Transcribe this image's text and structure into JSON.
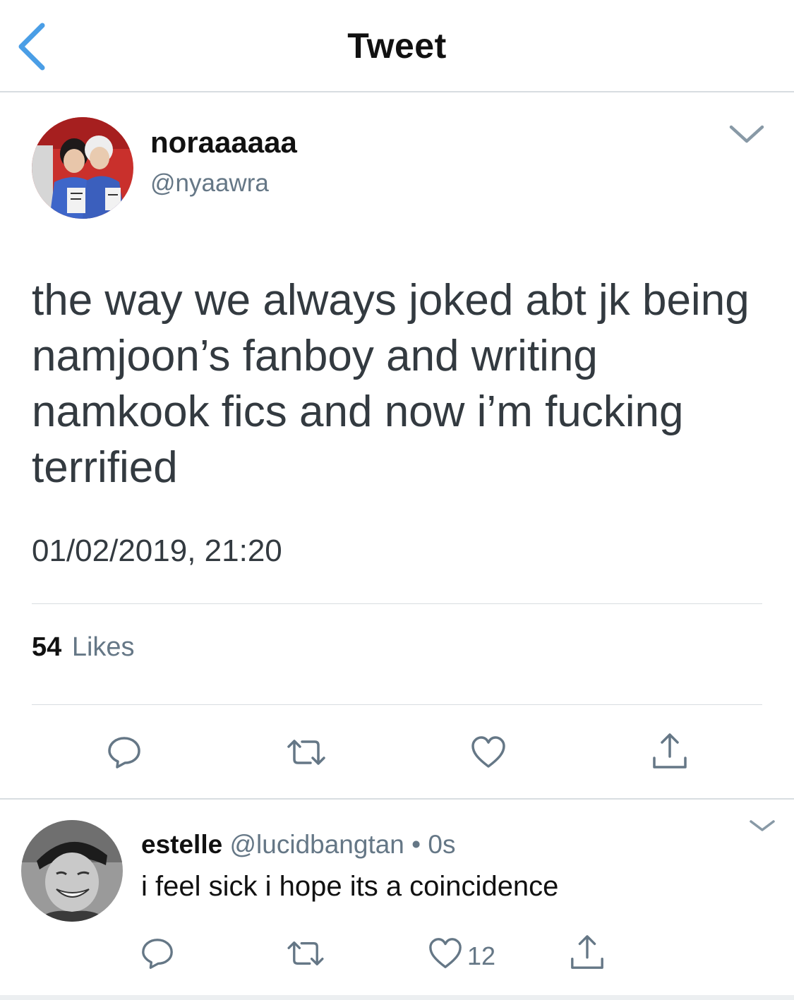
{
  "header": {
    "title": "Tweet",
    "back_icon": "chevron-left-icon",
    "accent_color": "#4A9EE6"
  },
  "tweet": {
    "display_name": "noraaaaaa",
    "handle": "@nyaawra",
    "text": "the way we always joked abt jk being namjoon’s fanboy and writing namkook fics and now i’m fucking terrified",
    "timestamp": "01/02/2019, 21:20",
    "likes_count": "54",
    "likes_label": "Likes",
    "actions": [
      "reply-icon",
      "retweet-icon",
      "like-icon",
      "share-icon"
    ]
  },
  "reply": {
    "display_name": "estelle",
    "handle": "@lucidbangtan",
    "separator": " • ",
    "time": "0s",
    "text": "i feel sick i hope its a coincidence",
    "like_count": "12",
    "actions": [
      "reply-icon",
      "retweet-icon",
      "like-icon",
      "share-icon"
    ]
  },
  "colors": {
    "text_primary": "#111111",
    "text_secondary": "#657786",
    "divider": "#D8DDE1"
  }
}
